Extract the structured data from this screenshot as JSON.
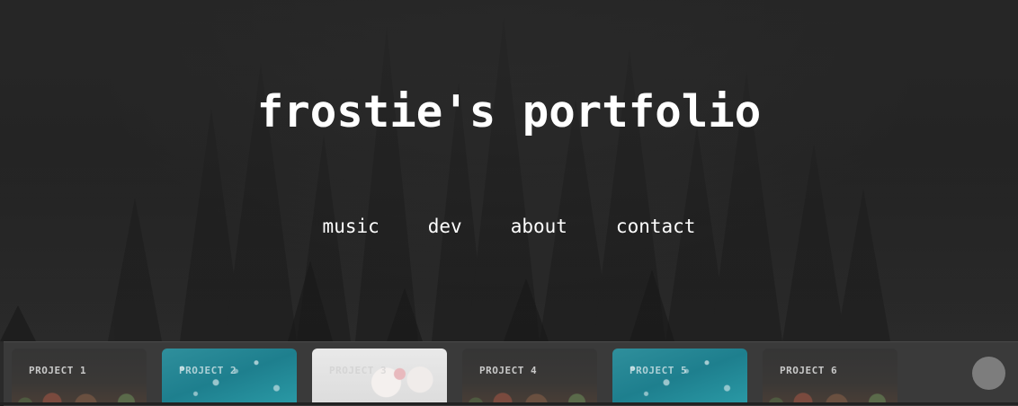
{
  "header": {
    "title": "frostie's portfolio"
  },
  "nav": {
    "items": [
      {
        "label": "music"
      },
      {
        "label": "dev"
      },
      {
        "label": "about"
      },
      {
        "label": "contact"
      }
    ]
  },
  "projects": {
    "items": [
      {
        "label": "PROJECT 1",
        "image": "flowers"
      },
      {
        "label": "PROJECT 2",
        "image": "water"
      },
      {
        "label": "PROJECT 3",
        "image": "white-flowers"
      },
      {
        "label": "PROJECT 4",
        "image": "flowers"
      },
      {
        "label": "PROJECT 5",
        "image": "water"
      },
      {
        "label": "PROJECT 6",
        "image": "flowers"
      }
    ]
  },
  "colors": {
    "background": "#1e1e1e",
    "text": "#ffffff",
    "strip": "#3a3a3a",
    "scroll_button": "#7d7d7d"
  },
  "icons": {
    "scroll_button": "circle-button-icon",
    "background": "misty-forest-image"
  }
}
